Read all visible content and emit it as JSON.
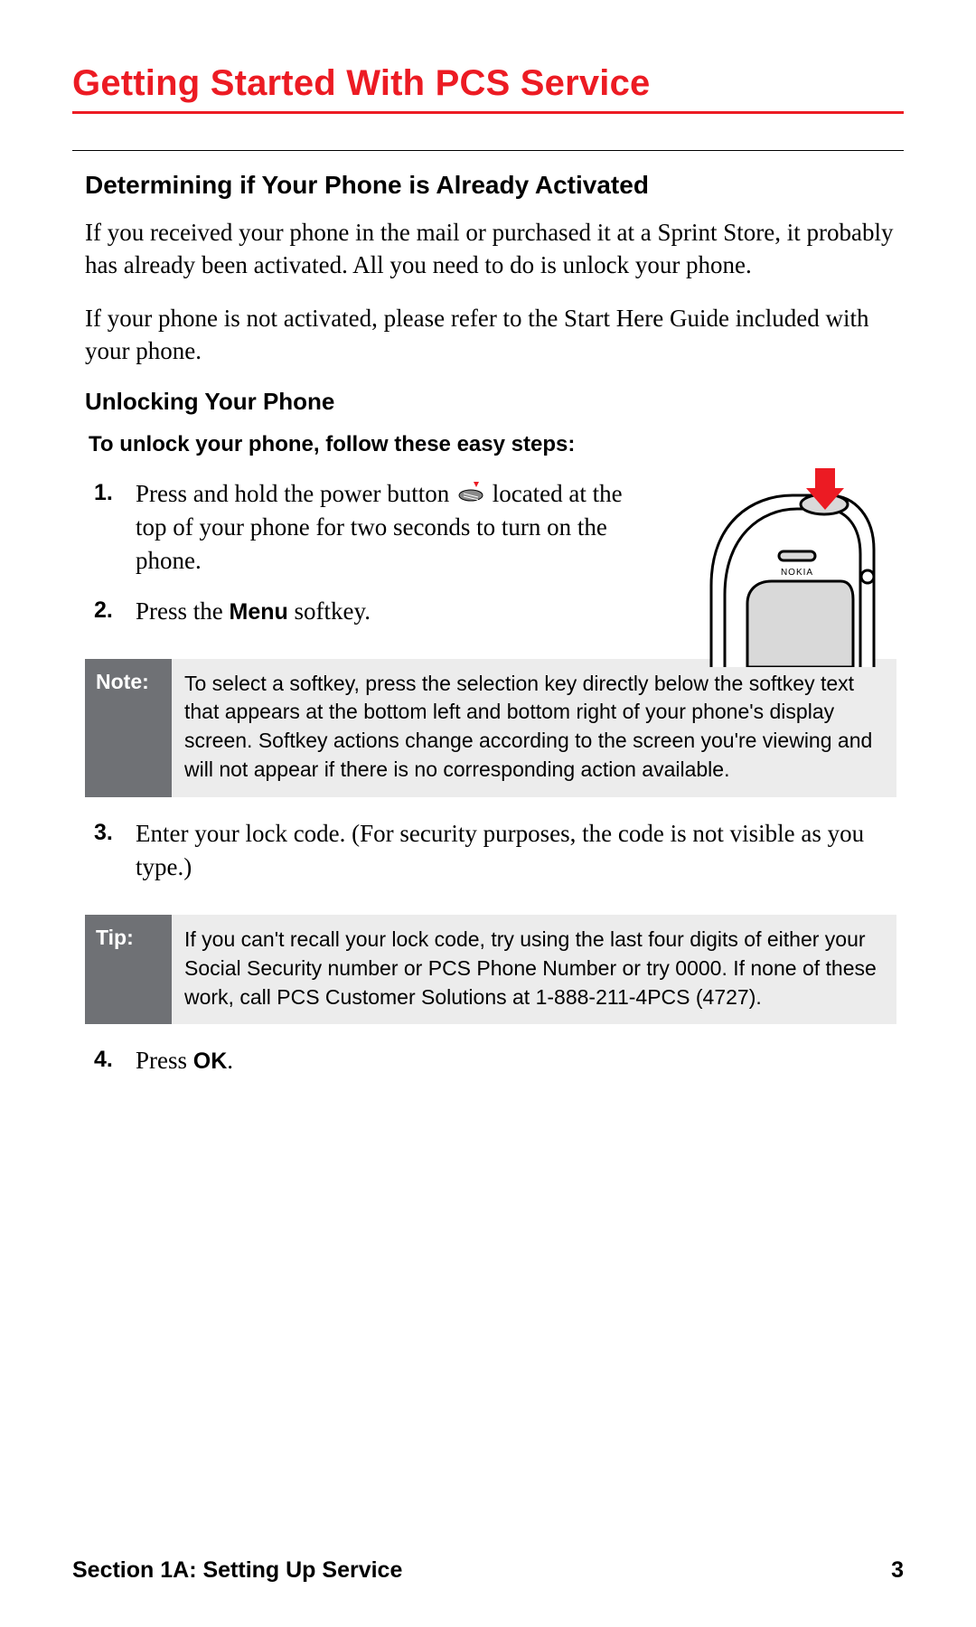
{
  "title": "Getting Started With PCS Service",
  "section1": {
    "heading": "Determining if Your Phone is Already Activated",
    "p1": "If you received your phone in the mail or purchased it at a Sprint Store, it probably has already been activated. All you need to do is unlock your phone.",
    "p2": "If your phone is not activated, please refer to the Start Here Guide included with your phone."
  },
  "section2": {
    "heading": "Unlocking Your Phone",
    "intro": "To unlock your phone, follow these easy steps:",
    "phone_brand": "NOKIA",
    "steps": {
      "s1a": "Press and hold the power button ",
      "s1b": " located at the top of your phone for two seconds to turn on the phone.",
      "s2a": "Press the ",
      "s2b": "Menu",
      "s2c": " softkey.",
      "s3": "Enter your lock code. (For security purposes, the code is not visible as you type.)",
      "s4a": "Press ",
      "s4b": "OK",
      "s4c": "."
    }
  },
  "note": {
    "label": "Note:",
    "body": "To select a softkey, press the selection key directly below the softkey text that appears at the bottom left and bottom right of your phone's display screen. Softkey actions change according to the screen you're viewing and will not appear if there is no corresponding action available."
  },
  "tip": {
    "label": "Tip:",
    "body": "If you can't recall your lock code, try using the last four digits of either your Social Security number or PCS Phone Number or try 0000. If none of these work, call PCS Customer Solutions at 1-888-211-4PCS (4727)."
  },
  "footer": {
    "section": "Section 1A: Setting Up Service",
    "page": "3"
  }
}
